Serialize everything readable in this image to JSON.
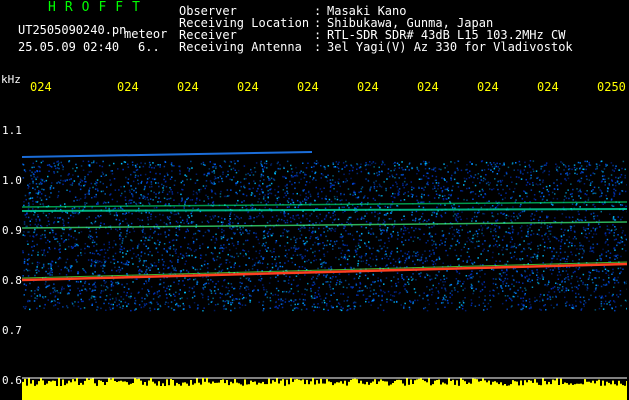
{
  "header": {
    "title": "HROFFT",
    "filename": "UT2505090240.pn",
    "mode": "meteor",
    "datetime": "25.05.09 02:40",
    "extra": "6..",
    "fields": [
      {
        "label": "Observer",
        "sep": ":",
        "value": "Masaki Kano"
      },
      {
        "label": "Receiving Location",
        "sep": ":",
        "value": "Shibukawa, Gunma, Japan"
      },
      {
        "label": "Receiver",
        "sep": ":",
        "value": "RTL-SDR SDR# 43dB L15 103.2MHz CW"
      },
      {
        "label": "Receiving Antenna",
        "sep": ":",
        "value": "3el Yagi(V) Az 330 for Vladivostok"
      }
    ]
  },
  "time_axis": {
    "ticks": [
      "024",
      "024",
      "024",
      "024",
      "024",
      "024",
      "024",
      "024",
      "024",
      "0250"
    ]
  },
  "freq_axis": {
    "unit": "kHz",
    "ticks": [
      "1.1",
      "1.0",
      "0.9",
      "0.8",
      "0.7",
      "0.6"
    ]
  },
  "colors": {
    "background": "#000000",
    "title": "#00ff00",
    "ticks": "#ffff00",
    "text": "#ffffff",
    "signal_low": "#0030c0",
    "signal_mid": "#00c0ff",
    "signal_high": "#ff4020",
    "power_bar": "#ffff00"
  }
}
